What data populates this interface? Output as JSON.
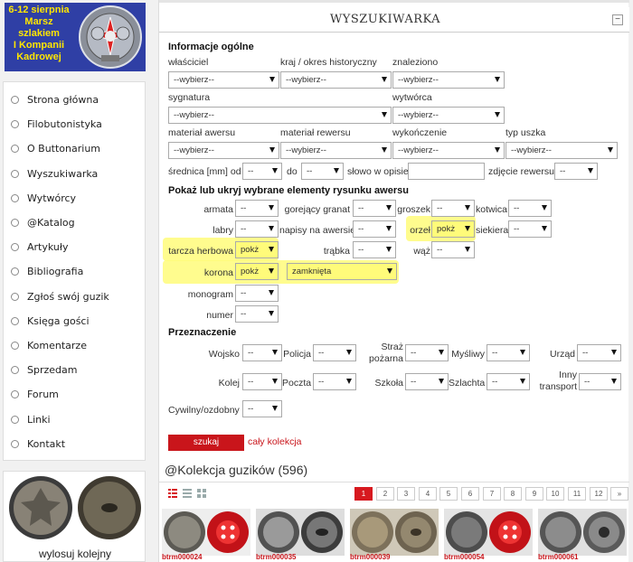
{
  "banner": {
    "lines": [
      "6-12 sierpnia",
      "Marsz",
      "szlakiem",
      "I Kompanii",
      "Kadrowej"
    ]
  },
  "menu": [
    "Strona główna",
    "Filobutonistyka",
    "O Buttonarium",
    "Wyszukiwarka",
    "Wytwórcy",
    "@Katalog",
    "Artykuły",
    "Bibliografia",
    "Zgłoś swój guzik",
    "Księga gości",
    "Komentarze",
    "Sprzedam",
    "Forum",
    "Linki",
    "Kontakt"
  ],
  "random": {
    "label": "wylosuj kolejny"
  },
  "search": {
    "title": "WYSZUKIWARKA",
    "collapse": "−",
    "general": {
      "heading": "Informacje ogólne",
      "owner_label": "właściciel",
      "owner_value": "--wybierz--",
      "country_label": "kraj / okres historyczny",
      "country_value": "--wybierz--",
      "found_label": "znaleziono",
      "found_value": "--wybierz--",
      "signature_label": "sygnatura",
      "signature_value": "--wybierz--",
      "maker_label": "wytwórca",
      "maker_value": "--wybierz--",
      "obverse_label": "materiał awersu",
      "obverse_value": "--wybierz--",
      "reverse_label": "materiał rewersu",
      "reverse_value": "--wybierz--",
      "finish_label": "wykończenie",
      "finish_value": "--wybierz--",
      "shank_label": "typ uszka",
      "shank_value": "--wybierz--",
      "diameter_from": "średnica [mm] od",
      "diameter_from_value": "--",
      "diameter_to": "do",
      "diameter_to_value": "--",
      "desc_word": "słowo w opisie",
      "photo_reverse": "zdjęcie rewersu",
      "photo_reverse_value": "--"
    },
    "elements": {
      "heading": "Pokaż lub ukryj wybrane elementy rysunku awersu",
      "armata": "armata",
      "armata_v": "--",
      "granat": "gorejący granat",
      "granat_v": "--",
      "groszek": "groszek",
      "groszek_v": "--",
      "kotwica": "kotwica",
      "kotwica_v": "--",
      "labry": "labry",
      "labry_v": "--",
      "napisy": "napisy na awersie",
      "napisy_v": "--",
      "orzel": "orzeł",
      "orzel_v": "pokż",
      "siekiera": "siekiera",
      "siekiera_v": "--",
      "tarcza": "tarcza herbowa",
      "tarcza_v": "pokż",
      "trabka": "trąbka",
      "trabka_v": "--",
      "waz": "wąż",
      "waz_v": "--",
      "korona": "korona",
      "korona_v": "pokż",
      "korona_type": "zamknięta",
      "monogram": "monogram",
      "monogram_v": "--",
      "numer": "numer",
      "numer_v": "--"
    },
    "purpose": {
      "heading": "Przeznaczenie",
      "wojsko": "Wojsko",
      "wojsko_v": "--",
      "policja": "Policja",
      "policja_v": "--",
      "straz1": "Straż",
      "straz2": "pożarna",
      "straz_v": "--",
      "mysliwy": "Myśliwy",
      "mysliwy_v": "--",
      "urzad": "Urząd",
      "urzad_v": "--",
      "kolej": "Kolej",
      "kolej_v": "--",
      "poczta": "Poczta",
      "poczta_v": "--",
      "szkola": "Szkoła",
      "szkola_v": "--",
      "szlachta": "Szlachta",
      "szlachta_v": "--",
      "inny1": "Inny",
      "inny2": "transport",
      "inny_v": "--",
      "cywilny": "Cywilny/ozdobny",
      "cywilny_v": "--"
    },
    "submit": "szukaj",
    "all": "cały kolekcja"
  },
  "collection": {
    "title": "@Kolekcja guzików (596)",
    "pages": [
      "1",
      "2",
      "3",
      "4",
      "5",
      "6",
      "7",
      "8",
      "9",
      "10",
      "11",
      "12",
      "»"
    ],
    "codes": [
      "btrm000024",
      "btrm000035",
      "btrm000039",
      "btrm000054",
      "btrm000061"
    ]
  }
}
